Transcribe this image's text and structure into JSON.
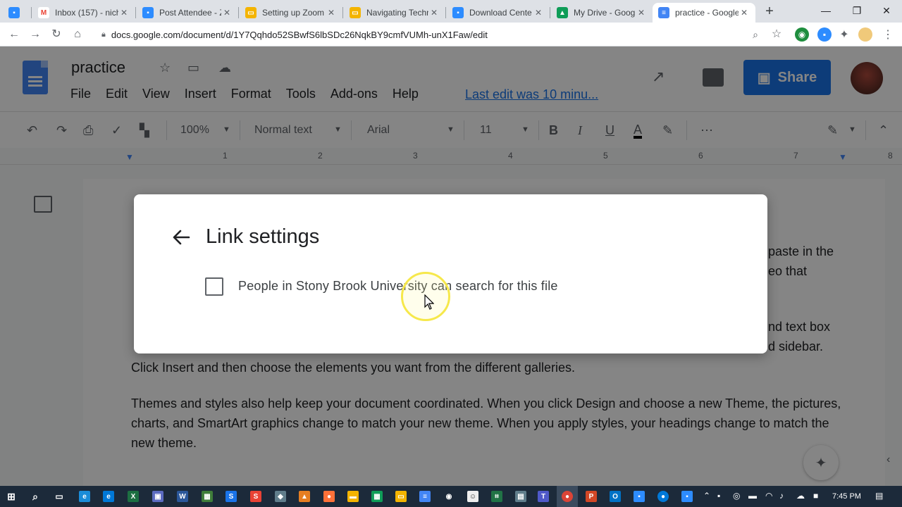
{
  "browser": {
    "tabs": [
      {
        "title": "",
        "favicon": "zoom-icon",
        "color": "#2d8cff"
      },
      {
        "title": "Inbox (157) - nich",
        "favicon": "gmail-icon",
        "color": "#ea4335"
      },
      {
        "title": "Post Attendee - Z",
        "favicon": "zoom-icon",
        "color": "#2d8cff"
      },
      {
        "title": "Setting up Zoom",
        "favicon": "slides-icon",
        "color": "#f4b400"
      },
      {
        "title": "Navigating Techn",
        "favicon": "slides-icon",
        "color": "#f4b400"
      },
      {
        "title": "Download Cente",
        "favicon": "zoom-icon",
        "color": "#2d8cff"
      },
      {
        "title": "My Drive - Googl",
        "favicon": "drive-icon",
        "color": "#0f9d58"
      },
      {
        "title": "practice - Google",
        "favicon": "docs-icon",
        "color": "#4285f4"
      }
    ],
    "url": "docs.google.com/document/d/1Y7Qqhdo52SBwfS6lbSDc26NqkBY9cmfVUMh-unX1Faw/edit",
    "extension_badge": "BETA"
  },
  "docs": {
    "title": "practice",
    "menu": [
      "File",
      "Edit",
      "View",
      "Insert",
      "Format",
      "Tools",
      "Add-ons",
      "Help"
    ],
    "last_edit": "Last edit was 10 minu...",
    "share_label": "Share",
    "toolbar": {
      "zoom": "100%",
      "style": "Normal text",
      "font": "Arial",
      "size": "11",
      "bold": "B",
      "italic": "I",
      "underline": "U",
      "text_color": "A"
    },
    "ruler_numbers": [
      "1",
      "2",
      "3",
      "4",
      "5",
      "6",
      "7",
      "8"
    ],
    "body": {
      "frag1": "paste in the",
      "frag2": "eo that",
      "frag3": "nd text box",
      "frag4": "d sidebar.",
      "line1": "Click Insert and then choose the elements you want from the different galleries.",
      "para2": "Themes and styles also help keep your document coordinated. When you click Design and choose a new Theme, the pictures, charts, and SmartArt graphics change to match your new theme. When you apply styles, your headings change to match the new theme."
    }
  },
  "dialog": {
    "title": "Link settings",
    "checkbox_label": "People in Stony Brook University can search for this file",
    "checkbox_checked": false
  },
  "taskbar": {
    "clock": "7:45 PM"
  }
}
